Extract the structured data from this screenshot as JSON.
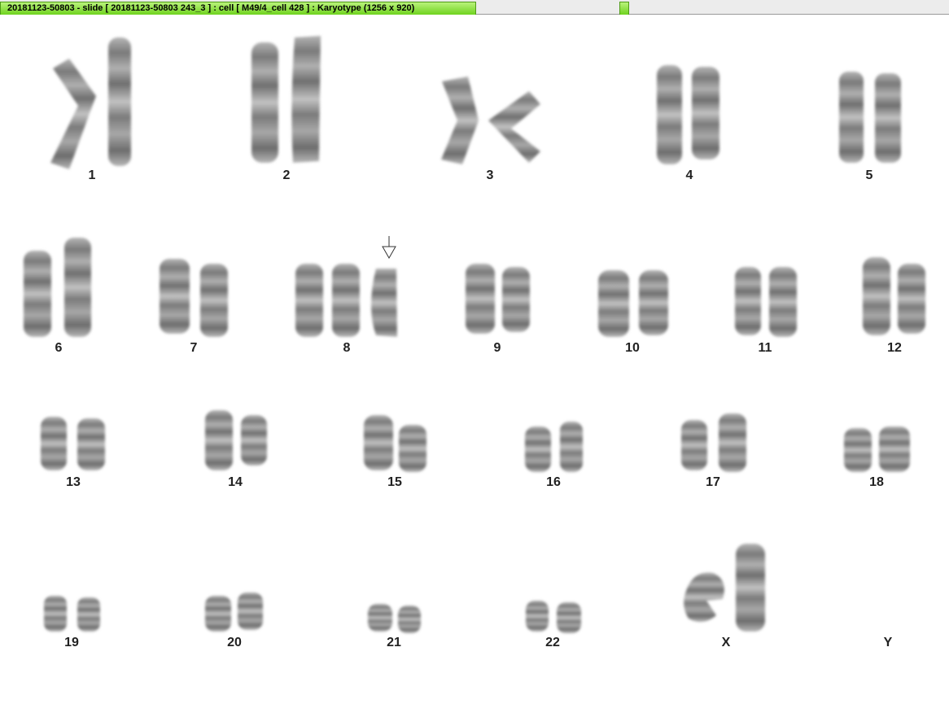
{
  "window": {
    "title": "20181123-50803 - slide [ 20181123-50803 243_3 ] : cell [ M49/4_cell 428 ] : Karyotype  (1256 x 920)"
  },
  "karyotype": {
    "labels": [
      "1",
      "2",
      "3",
      "4",
      "5",
      "6",
      "7",
      "8",
      "9",
      "10",
      "11",
      "12",
      "13",
      "14",
      "15",
      "16",
      "17",
      "18",
      "19",
      "20",
      "21",
      "22",
      "X",
      "Y"
    ]
  },
  "colors": {
    "tab_green": "#7fdc2a",
    "chromosome_gray": "#8c8c8c"
  },
  "icons": {
    "marker": "down-arrow-icon"
  }
}
